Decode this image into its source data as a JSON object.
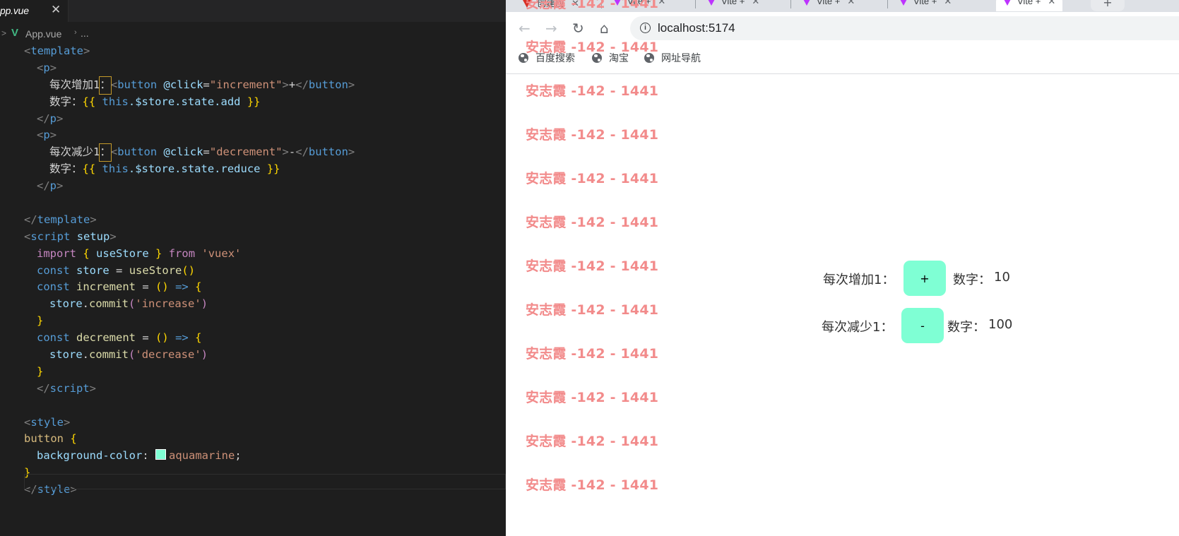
{
  "editor": {
    "tab_label": "pp.vue",
    "tab_close": "✕",
    "breadcrumb_file": "App.vue",
    "breadcrumb_more": "...",
    "line_numbers": [
      "",
      "",
      "",
      "",
      "",
      "",
      "",
      "",
      "",
      "",
      "",
      "",
      "",
      "",
      "",
      "",
      "",
      "",
      "",
      "",
      "",
      "",
      "",
      "",
      "",
      "",
      "",
      ""
    ]
  },
  "code": {
    "l1_tag": "template",
    "l2_tag": "p",
    "l3_text": "每次增加1",
    "l3_colon": "：",
    "l3_tag": "button",
    "l3_attr": "@click",
    "l3_eq": "=",
    "l3_val": "\"increment\"",
    "l3_content": "+",
    "l3_closetag": "button",
    "l4_text": "数字：",
    "l4_open": "{{",
    "l4_this": "this",
    "l4_expr": ".$store.state.add",
    "l4_close": "}}",
    "l5_tag": "p",
    "l6_tag": "p",
    "l7_text": "每次减少1",
    "l7_colon": "：",
    "l7_tag": "button",
    "l7_attr": "@click",
    "l7_eq": "=",
    "l7_val": "\"decrement\"",
    "l7_content": "-",
    "l7_closetag": "button",
    "l8_text": "数字：",
    "l8_open": "{{",
    "l8_this": "this",
    "l8_expr": ".$store.state.reduce",
    "l8_close": "}}",
    "l9_tag": "p",
    "l11_tag": "template",
    "l12_tag": "script",
    "l12_attr": "setup",
    "l13_import": "import",
    "l13_lb": "{",
    "l13_name": "useStore",
    "l13_rb": "}",
    "l13_from": "from",
    "l13_str": "'vuex'",
    "l14_const": "const",
    "l14_var": "store",
    "l14_eq": "=",
    "l14_fn": "useStore",
    "l14_paren": "()",
    "l15_const": "const",
    "l15_var": "increment",
    "l15_eq": "=",
    "l15_paren": "()",
    "l15_arrow": "=>",
    "l15_lb": "{",
    "l16_obj": "store",
    "l16_dot": ".",
    "l16_fn": "commit",
    "l16_lp": "(",
    "l16_str": "'increase'",
    "l16_rp": ")",
    "l17_rb": "}",
    "l18_const": "const",
    "l18_var": "decrement",
    "l18_eq": "=",
    "l18_paren": "()",
    "l18_arrow": "=>",
    "l18_lb": "{",
    "l19_obj": "store",
    "l19_dot": ".",
    "l19_fn": "commit",
    "l19_lp": "(",
    "l19_str": "'decrease'",
    "l19_rp": ")",
    "l20_rb": "}",
    "l21_tag": "script",
    "l23_tag": "style",
    "l24_sel": "button",
    "l24_lb": "{",
    "l25_prop": "background-color",
    "l25_colon": ":",
    "l25_val": "aquamarine",
    "l25_semi": ";",
    "l26_rb": "}",
    "l27_tag": "style",
    "swatch_color": "#7fffd4"
  },
  "browser": {
    "tabs": [
      {
        "label": "创建应",
        "close": "✕"
      },
      {
        "label": "Vite +",
        "close": "✕"
      },
      {
        "label": "Vite +",
        "close": "✕"
      },
      {
        "label": "Vite +",
        "close": "✕"
      },
      {
        "label": "Vite +",
        "close": "✕"
      },
      {
        "label": "Vite +",
        "close": "✕"
      }
    ],
    "new_tab": "+",
    "url": "localhost:5174",
    "bookmarks": [
      "百度搜索",
      "淘宝",
      "网址导航"
    ]
  },
  "page": {
    "watermark": "安志霞 -142 - 1441",
    "watermark_color": "#f28b8b",
    "inc_label": "每次增加1：",
    "inc_button": "+",
    "inc_count_label": "数字：",
    "inc_count": "10",
    "dec_label": "每次减少1：",
    "dec_button": "-",
    "dec_count_label": "数字：",
    "dec_count": "100",
    "button_color": "#7fffd4"
  }
}
